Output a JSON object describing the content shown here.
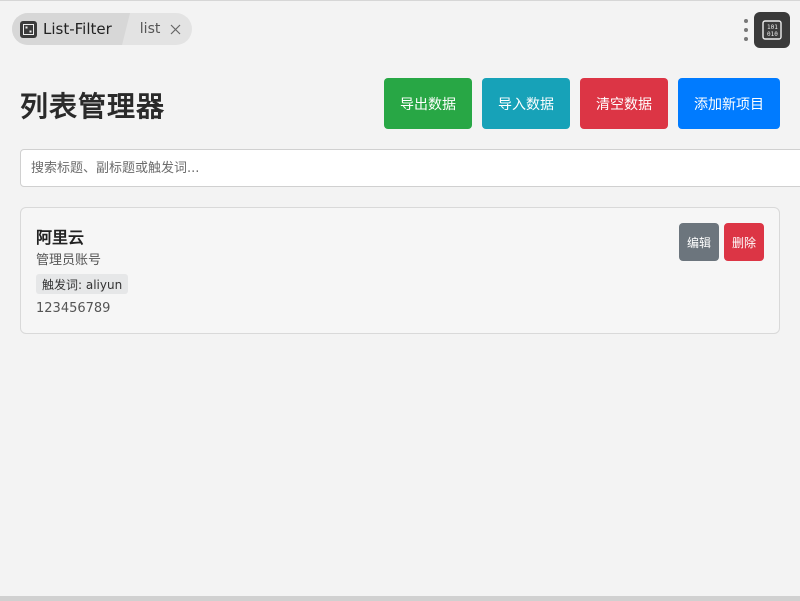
{
  "colors": {
    "export": "#28a745",
    "import": "#17a2b8",
    "clear": "#dc3545",
    "add": "#007bff",
    "edit": "#6c757d",
    "delete": "#dc3545"
  },
  "tabbar": {
    "app_title": "List-Filter",
    "sub_tab": "list",
    "app_icon": "binary-icon",
    "menu_icon": "kebab-icon",
    "extension_icon": "binary-icon"
  },
  "header": {
    "title": "列表管理器",
    "buttons": {
      "export": "导出数据",
      "import": "导入数据",
      "clear": "清空数据",
      "add": "添加新项目"
    }
  },
  "search": {
    "placeholder": "搜索标题、副标题或触发词...",
    "value": ""
  },
  "items": [
    {
      "title": "阿里云",
      "subtitle": "管理员账号",
      "trigger": "触发词: aliyun",
      "content": "123456789",
      "edit_label": "编辑",
      "delete_label": "删除"
    }
  ]
}
